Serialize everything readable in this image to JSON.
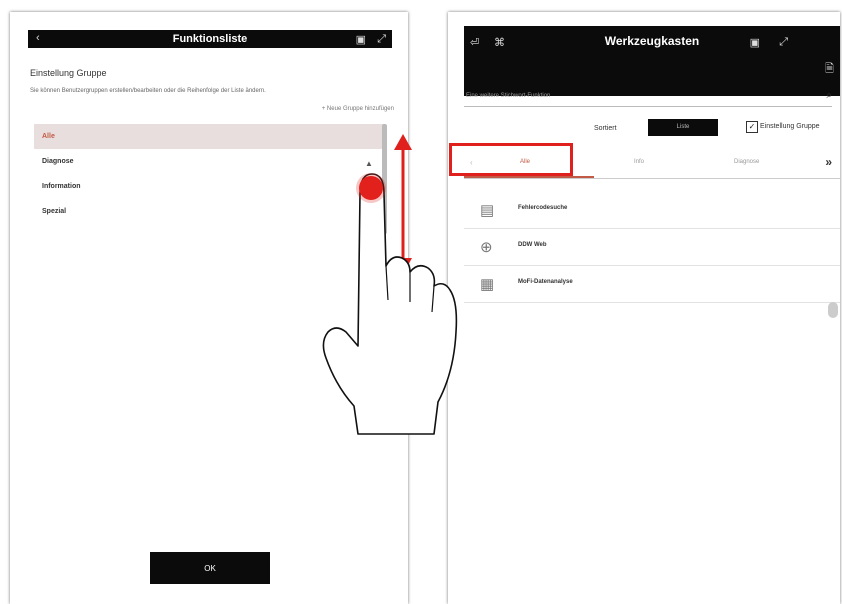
{
  "left_screen": {
    "header": {
      "title": "Funktionsliste",
      "back_icon": "‹",
      "icon1": "▣",
      "icon2": "⤢"
    },
    "section_title": "Einstellung Gruppe",
    "section_desc": "Sie können Benutzergruppen erstellen/bearbeiten oder die Reihenfolge der Liste ändern.",
    "add_group_link": "+ Neue Gruppe hinzufügen",
    "groups": [
      {
        "label": "Alle",
        "selected": true
      },
      {
        "label": "Diagnose",
        "selected": false
      },
      {
        "label": "Information",
        "selected": false
      },
      {
        "label": "Spezial",
        "selected": false
      }
    ],
    "ok_label": "OK"
  },
  "right_screen": {
    "header": {
      "title": "Werkzeugkasten",
      "icon_left1": "⏎",
      "icon_left2": "⌘",
      "icon_r1": "▣",
      "icon_r2": "⤢",
      "icon_r3": "🗎"
    },
    "search_placeholder": "Eine weitere Stichwort-Funktion",
    "mode_label": "Sortiert",
    "mode_button": "Liste",
    "checkbox_label": "Einstellung Gruppe",
    "checkbox_mark": "✓",
    "tabs": [
      "Alle",
      "Info",
      "Diagnose"
    ],
    "tab_prev": "‹",
    "tab_next": "»",
    "tools": [
      {
        "label": "Fehlercodesuche",
        "icon": "▤"
      },
      {
        "label": "DDW Web",
        "icon": "⊕"
      },
      {
        "label": "MoFi-Datenanalyse",
        "icon": "▦"
      }
    ]
  },
  "colors": {
    "accent": "#c35a45",
    "highlight": "#e0201c",
    "bar": "#0b0b0b"
  }
}
